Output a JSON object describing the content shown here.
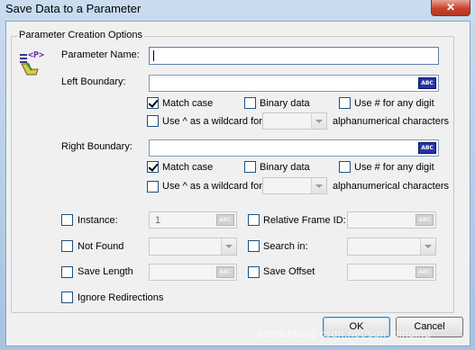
{
  "window": {
    "title": "Save Data to a Parameter",
    "close_glyph": "✕"
  },
  "group": {
    "legend": "Parameter Creation Options",
    "icon": "param-icon",
    "icon_text": "<P>"
  },
  "param_name": {
    "label": "Parameter Name:",
    "value": ""
  },
  "left_boundary": {
    "label": "Left Boundary:",
    "value": "",
    "abc": "ABC",
    "match_case": "Match case",
    "binary_data": "Binary data",
    "use_hash": "Use # for any digit",
    "use_caret": "Use ^ as a wildcard for",
    "alnum": "alphanumerical characters"
  },
  "right_boundary": {
    "label": "Right Boundary:",
    "value": "",
    "abc": "ABC",
    "match_case": "Match case",
    "binary_data": "Binary data",
    "use_hash": "Use # for any digit",
    "use_caret": "Use ^ as a wildcard for",
    "alnum": "alphanumerical characters"
  },
  "options": {
    "instance": {
      "label": "Instance:",
      "value": "1",
      "abc": "ABC"
    },
    "relative_frame": {
      "label": "Relative Frame ID:",
      "abc": "ABC"
    },
    "not_found": {
      "label": "Not Found"
    },
    "search_in": {
      "label": "Search in:"
    },
    "save_length": {
      "label": "Save Length",
      "abc": "ABC"
    },
    "save_offset": {
      "label": "Save Offset",
      "abc": "ABC"
    },
    "ignore_redirections": {
      "label": "Ignore Redirections"
    }
  },
  "buttons": {
    "ok": "OK",
    "cancel": "Cancel"
  },
  "watermark": "https://blog.csdn.net/sun_binding",
  "colors": {
    "accent_blue": "#2532a8",
    "title_bar": "#a6c2e0",
    "close_red": "#c7432d"
  }
}
